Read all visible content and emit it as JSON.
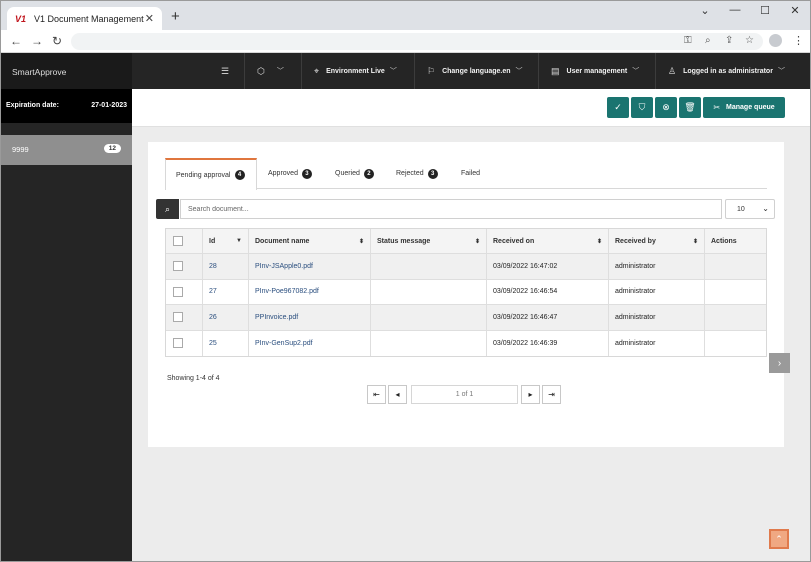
{
  "browser": {
    "tab_logo": "V1",
    "tab_title": "V1 Document Management",
    "tab_close": "✕",
    "new_tab": "+",
    "controls": [
      "⌄",
      "—",
      "☐",
      "✕"
    ]
  },
  "sidebar": {
    "brand": "SmartApprove",
    "expiration_label": "Expiration date:",
    "expiration_value": "27-01-2023",
    "item_label": "9999",
    "item_count": "12"
  },
  "topnav": {
    "menu_icon": "menu-icon",
    "environment": "Environment Live",
    "language": "Change language.en",
    "user_management": "User management",
    "logged_in": "Logged in as administrator"
  },
  "actions": {
    "manage_queue": "Manage queue"
  },
  "tabs": [
    {
      "label": "Pending approval",
      "count": "4"
    },
    {
      "label": "Approved",
      "count": "3"
    },
    {
      "label": "Queried",
      "count": "2"
    },
    {
      "label": "Rejected",
      "count": "3"
    },
    {
      "label": "Failed",
      "count": ""
    }
  ],
  "search": {
    "placeholder": "Search document...",
    "page_size": "10"
  },
  "table": {
    "headers": [
      "Id",
      "Document name",
      "Status message",
      "Received on",
      "Received by",
      "Actions"
    ],
    "rows": [
      {
        "id": "28",
        "name": "PInv-JSApple0.pdf",
        "status": "",
        "received_on": "03/09/2022 16:47:02",
        "received_by": "administrator"
      },
      {
        "id": "27",
        "name": "PInv-Poe967082.pdf",
        "status": "",
        "received_on": "03/09/2022 16:46:54",
        "received_by": "administrator"
      },
      {
        "id": "26",
        "name": "PPInvoice.pdf",
        "status": "",
        "received_on": "03/09/2022 16:46:47",
        "received_by": "administrator"
      },
      {
        "id": "25",
        "name": "PInv-GenSup2.pdf",
        "status": "",
        "received_on": "03/09/2022 16:46:39",
        "received_by": "administrator"
      }
    ]
  },
  "pagination": {
    "showing": "Showing 1-4 of 4",
    "page_info": "1 of 1"
  },
  "colors": {
    "accent": "#1a7470",
    "tab_active": "#e0763e",
    "dark": "#252525"
  }
}
